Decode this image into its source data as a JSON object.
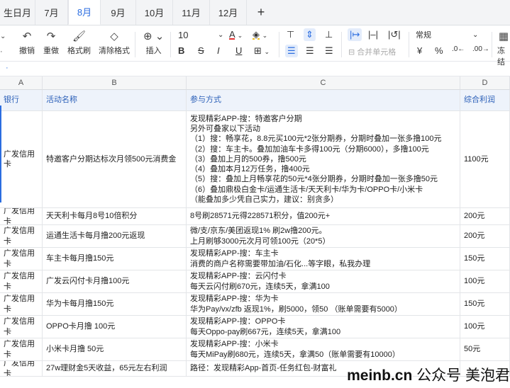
{
  "tabs": [
    "生日月",
    "7月",
    "8月",
    "9月",
    "10月",
    "11月",
    "12月"
  ],
  "active_tab": "8月",
  "toolbar": {
    "undo": "撤销",
    "redo": "重做",
    "format_painter": "格式刷",
    "clear_format": "清除格式",
    "insert": "插入",
    "font_size": "10",
    "merge_cells": "合并单元格",
    "number_format": "常规",
    "freeze": "冻结",
    "currency": "¥",
    "percent": "%"
  },
  "columns": [
    "A",
    "B",
    "C",
    "D"
  ],
  "table": {
    "headers": [
      "银行",
      "活动名称",
      "参与方式",
      "综合利润"
    ],
    "rows": [
      {
        "bank": "广发信用卡",
        "activity": "特邀客户分期达标次月领500元消费金",
        "method": [
          "发现精彩APP-搜：特邀客户分期",
          "另外可叠家以下活动",
          "（1）搜：畅享花，8.8元买100元*2张分期券，分期时叠加一张多撸100元",
          "（2）搜：车主卡。叠加加油车卡多得100元（分期6000），多撸100元",
          "（3）叠加上月的500券，撸500元",
          "（4）叠加本月12万任务，撸400元",
          "（5）搜：叠加上月畅享花的50元*4张分期券，分期时叠加一张多撸50元",
          "（6）叠加鼎极白金卡/运通生活卡/天天利卡/华为卡/OPPO卡/小米卡",
          "（能叠加多少凭自己实力，建议：别贪多）"
        ],
        "profit": "1100元"
      },
      {
        "bank": "广发信用卡",
        "activity": "天天利卡每月8号10倍积分",
        "method": [
          "8号刷28571元得228571积分，值200元+"
        ],
        "profit": "200元"
      },
      {
        "bank": "广发信用卡",
        "activity": "运通生活卡每月撸200元返现",
        "method": [
          "微/支/京东/美团返现1% 刷2w撸200元。",
          "上月刷够3000元次月可领100元（20*5）"
        ],
        "profit": "200元"
      },
      {
        "bank": "广发信用卡",
        "activity": "车主卡每月撸150元",
        "method": [
          "发现精彩APP-搜：车主卡",
          "消费的商户名称需要带加油/石化...等字眼，私我办理"
        ],
        "profit": "150元"
      },
      {
        "bank": "广发信用卡",
        "activity": "广发云闪付卡月撸100元",
        "method": [
          "发现精彩APP-搜：云闪付卡",
          "每天云闪付刷670元，连续5天，拿满100"
        ],
        "profit": "100元"
      },
      {
        "bank": "广发信用卡",
        "activity": "华为卡每月撸150元",
        "method": [
          "发现精彩APP-搜：华为卡",
          "华为Pay/vx/zfb 返现1%，刷5000，领50 （账单需要有5000）"
        ],
        "profit": "150元"
      },
      {
        "bank": "广发信用卡",
        "activity": "OPPO卡月撸 100元",
        "method": [
          "发现精彩APP-搜：OPPO卡",
          "每天Oppo-pay刷667元，连续5天，拿满100"
        ],
        "profit": "100元"
      },
      {
        "bank": "广发信用卡",
        "activity": "小米卡月撸 50元",
        "method": [
          "发现精彩APP-搜：小米卡",
          "每天MiPay刷680元，连续5天，拿满50（账单需要有10000）"
        ],
        "profit": "50元"
      },
      {
        "bank": "广发信用卡",
        "activity": "27w理财金5天收益，65元左右利润",
        "method": [
          "路径：发现精彩App-首页-任务红包-财富礼"
        ],
        "profit": ""
      }
    ]
  },
  "watermark": {
    "site": "meinb.cn",
    "label": "公众号 美泡君"
  }
}
